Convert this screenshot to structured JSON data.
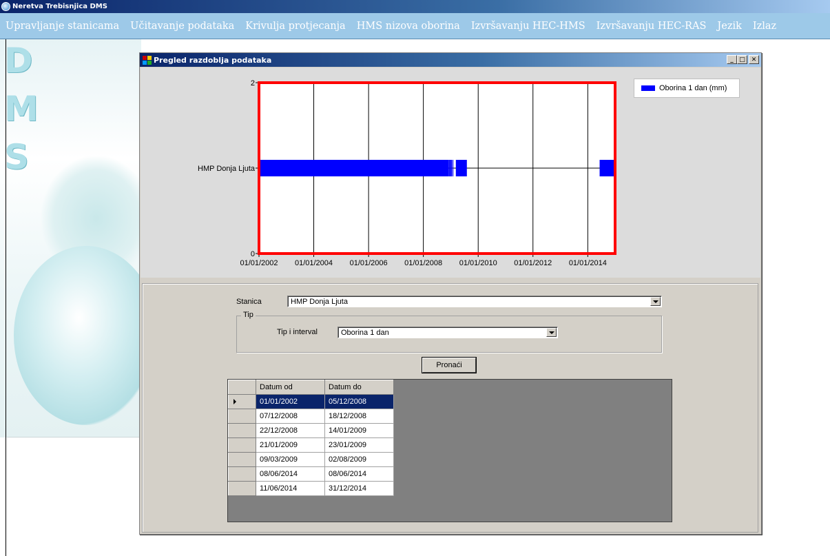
{
  "app": {
    "title": "Neretva Trebisnjica DMS"
  },
  "menu": [
    {
      "label": "Upravljanje stanicama"
    },
    {
      "label": "Učitavanje podataka"
    },
    {
      "label": "Krivulja protjecanja"
    },
    {
      "label": "HMS nizova oborina"
    },
    {
      "label": "Izvršavanju HEC-HMS"
    },
    {
      "label": "Izvršavanju HEC-RAS"
    },
    {
      "label": "Jezik"
    },
    {
      "label": "Izlaz"
    }
  ],
  "background": {
    "letters": [
      "D",
      "M",
      "S"
    ]
  },
  "window": {
    "title": "Pregled razdoblja podataka",
    "buttons": {
      "minimize": "_",
      "maximize": "□",
      "close": "✕"
    }
  },
  "chart_data": {
    "type": "timeline",
    "x_axis": {
      "type": "date",
      "ticks": [
        "01/01/2002",
        "01/01/2004",
        "01/01/2006",
        "01/01/2008",
        "01/01/2010",
        "01/01/2012",
        "01/01/2014"
      ],
      "range": [
        "2002-01-01",
        "2014-12-31"
      ]
    },
    "y_axis": {
      "ticks": [
        {
          "value": 0,
          "label": "0"
        },
        {
          "value": 2,
          "label": "2"
        }
      ],
      "range": [
        0,
        2
      ]
    },
    "categories": [
      {
        "value": 1,
        "label": "HMP Donja Ljuta"
      }
    ],
    "series": [
      {
        "name": "Oborina 1 dan (mm)",
        "color": "#0000ff",
        "intervals": [
          [
            "2002-01-01",
            "2008-12-05"
          ],
          [
            "2008-12-07",
            "2008-12-18"
          ],
          [
            "2008-12-22",
            "2009-01-14"
          ],
          [
            "2009-01-21",
            "2009-01-23"
          ],
          [
            "2009-03-09",
            "2009-08-02"
          ],
          [
            "2014-06-08",
            "2014-06-08"
          ],
          [
            "2014-06-11",
            "2014-12-31"
          ]
        ]
      }
    ],
    "grid": true,
    "legend": "top-right",
    "plot_border_color": "#ff0000"
  },
  "form": {
    "station_label": "Stanica",
    "station_value": "HMP Donja Ljuta",
    "type_group_label": "Tip",
    "type_interval_label": "Tip i interval",
    "type_interval_value": "Oborina 1 dan",
    "find_button": "Pronaći"
  },
  "grid": {
    "headers": [
      "Datum od",
      "Datum do"
    ],
    "rows": [
      {
        "from": "01/01/2002",
        "to": "05/12/2008",
        "selected": true
      },
      {
        "from": "07/12/2008",
        "to": "18/12/2008"
      },
      {
        "from": "22/12/2008",
        "to": "14/01/2009"
      },
      {
        "from": "21/01/2009",
        "to": "23/01/2009"
      },
      {
        "from": "09/03/2009",
        "to": "02/08/2009"
      },
      {
        "from": "08/06/2014",
        "to": "08/06/2014"
      },
      {
        "from": "11/06/2014",
        "to": "31/12/2014"
      }
    ]
  }
}
